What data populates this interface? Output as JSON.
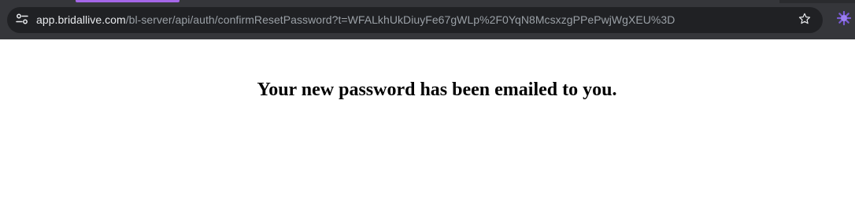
{
  "browser": {
    "url_host": "app.bridallive.com",
    "url_path": "/bl-server/api/auth/confirmResetPassword?t=WFALkhUkDiuyFe67gWLp%2F0YqN8McsxzgPPePwjWgXEU%3D",
    "icons": {
      "site_info": "site-info-tune-icon",
      "bookmark": "star-icon",
      "extension": "extension-icon"
    },
    "colors": {
      "chrome_bg": "#35363a",
      "omnibox_bg": "#202124",
      "tab_accent": "#a566e8",
      "extension": "#7b5cd6"
    }
  },
  "page": {
    "message": "Your new password has been emailed to you."
  }
}
